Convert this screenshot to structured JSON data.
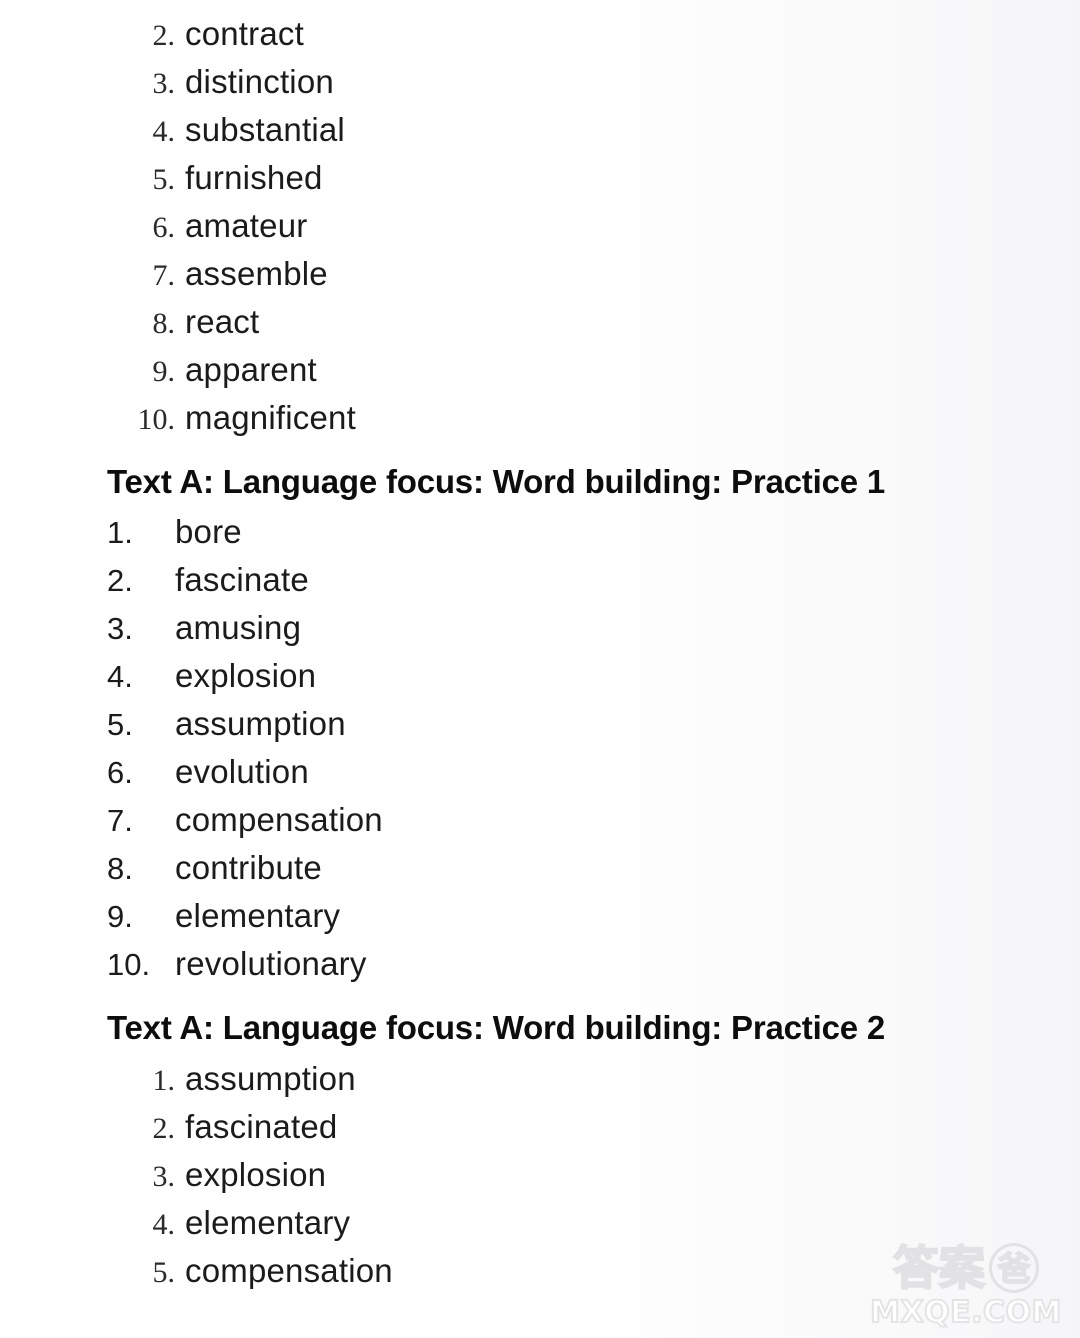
{
  "document": {
    "type": "answer-key-page",
    "background_color": "#fefefe",
    "text_color": "#1b1b1b"
  },
  "sections": [
    {
      "id": "list-0",
      "kind": "list",
      "numeral_style": "serif",
      "items": [
        {
          "number": "2.",
          "word": "contract"
        },
        {
          "number": "3.",
          "word": "distinction"
        },
        {
          "number": "4.",
          "word": "substantial"
        },
        {
          "number": "5.",
          "word": "furnished"
        },
        {
          "number": "6.",
          "word": "amateur"
        },
        {
          "number": "7.",
          "word": "assemble"
        },
        {
          "number": "8.",
          "word": "react"
        },
        {
          "number": "9.",
          "word": "apparent"
        },
        {
          "number": "10.",
          "word": "magnificent"
        }
      ]
    },
    {
      "id": "heading-0",
      "kind": "heading",
      "text": "Text A: Language focus: Word building: Practice 1"
    },
    {
      "id": "list-1",
      "kind": "list",
      "numeral_style": "sans",
      "items": [
        {
          "number": "1.",
          "word": "bore"
        },
        {
          "number": "2.",
          "word": "fascinate"
        },
        {
          "number": "3.",
          "word": "amusing"
        },
        {
          "number": "4.",
          "word": "explosion"
        },
        {
          "number": "5.",
          "word": "assumption"
        },
        {
          "number": "6.",
          "word": "evolution"
        },
        {
          "number": "7.",
          "word": "compensation"
        },
        {
          "number": "8.",
          "word": "contribute"
        },
        {
          "number": "9.",
          "word": "elementary"
        },
        {
          "number": "10.",
          "word": "revolutionary"
        }
      ]
    },
    {
      "id": "heading-1",
      "kind": "heading",
      "text": "Text A: Language focus: Word building: Practice 2"
    },
    {
      "id": "list-2",
      "kind": "list",
      "numeral_style": "serif",
      "items": [
        {
          "number": "1.",
          "word": "assumption"
        },
        {
          "number": "2.",
          "word": "fascinated"
        },
        {
          "number": "3.",
          "word": "explosion"
        },
        {
          "number": "4.",
          "word": "elementary"
        },
        {
          "number": "5.",
          "word": "compensation"
        }
      ]
    }
  ],
  "watermark": {
    "chinese_prefix": "答案",
    "chinese_circled": "爸",
    "domain": "MXQE.COM",
    "color": "#e2e2e4"
  }
}
